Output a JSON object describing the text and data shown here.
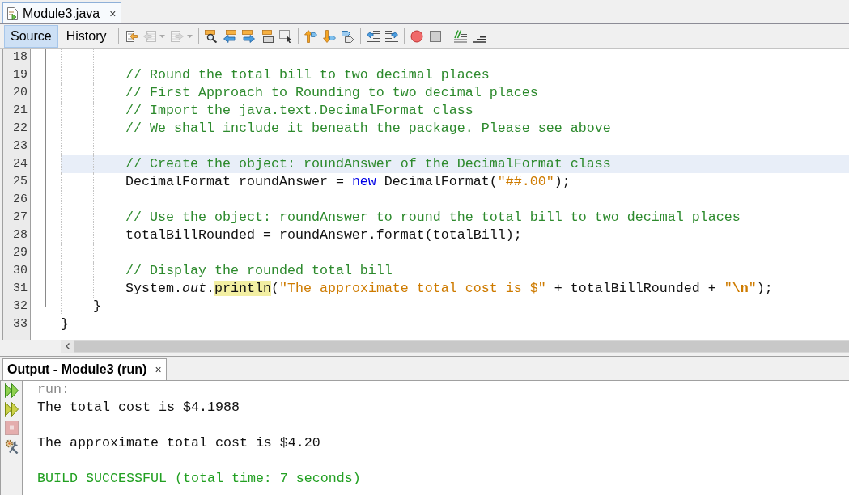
{
  "editor_tab": {
    "title": "Module3.java",
    "close": "×"
  },
  "view_tabs": [
    {
      "label": "Source",
      "selected": true
    },
    {
      "label": "History",
      "selected": false
    }
  ],
  "toolbar": [
    [
      {
        "kind": "button",
        "disabled": false
      },
      {
        "kind": "split",
        "disabled": true
      },
      {
        "kind": "split",
        "disabled": true
      }
    ],
    [
      {
        "kind": "button",
        "disabled": false
      },
      {
        "kind": "button",
        "disabled": false
      },
      {
        "kind": "button",
        "disabled": false
      },
      {
        "kind": "button",
        "disabled": false
      },
      {
        "kind": "button",
        "disabled": false
      }
    ],
    [
      {
        "kind": "button",
        "disabled": false
      },
      {
        "kind": "button",
        "disabled": false
      },
      {
        "kind": "button",
        "disabled": false
      }
    ],
    [
      {
        "kind": "button",
        "disabled": false
      },
      {
        "kind": "button",
        "disabled": false
      }
    ],
    [
      {
        "kind": "button",
        "disabled": false
      },
      {
        "kind": "button",
        "disabled": false
      }
    ],
    [
      {
        "kind": "button",
        "disabled": false
      },
      {
        "kind": "button",
        "disabled": false
      }
    ]
  ],
  "editor": {
    "code": [
      {
        "children": [
          {
            "children": [
              {
                "number": "18",
                "current": false
              },
              {
                "number": "19",
                "current": false,
                "tokens": [
                  {
                    "kind": "comment",
                    "text": "// Round the total bill to two decimal places"
                  }
                ]
              },
              {
                "number": "20",
                "current": false,
                "tokens": [
                  {
                    "kind": "comment",
                    "text": "// First Approach to Rounding to two decimal places"
                  }
                ]
              },
              {
                "number": "21",
                "current": false,
                "tokens": [
                  {
                    "kind": "comment",
                    "text": "// Import the java.text.DecimalFormat class"
                  }
                ]
              },
              {
                "number": "22",
                "current": false,
                "tokens": [
                  {
                    "kind": "comment",
                    "text": "// We shall include it beneath the package. Please see above"
                  }
                ]
              },
              {
                "number": "23",
                "current": false
              },
              {
                "number": "24",
                "current": true,
                "tokens": [
                  {
                    "kind": "comment",
                    "text": "// Create the object: roundAnswer of the DecimalFormat class"
                  }
                ]
              },
              {
                "number": "25",
                "current": false,
                "tokens": [
                  {
                    "kind": "text",
                    "text": "DecimalFormat roundAnswer = "
                  },
                  {
                    "kind": "keyword",
                    "text": "new"
                  },
                  {
                    "kind": "text",
                    "text": " DecimalFormat("
                  },
                  {
                    "kind": "string",
                    "text": "\"##.00\""
                  },
                  {
                    "kind": "text",
                    "text": ");"
                  }
                ]
              },
              {
                "number": "26",
                "current": false
              },
              {
                "number": "27",
                "current": false,
                "tokens": [
                  {
                    "kind": "comment",
                    "text": "// Use the object: roundAnswer to round the total bill to two decimal places"
                  }
                ]
              },
              {
                "number": "28",
                "current": false,
                "tokens": [
                  {
                    "kind": "text",
                    "text": "totalBillRounded = roundAnswer.format(totalBill);"
                  }
                ]
              },
              {
                "number": "29",
                "current": false
              },
              {
                "number": "30",
                "current": false,
                "tokens": [
                  {
                    "kind": "comment",
                    "text": "// Display the rounded total bill"
                  }
                ]
              },
              {
                "number": "31",
                "current": false,
                "tokens": [
                  {
                    "kind": "text",
                    "text": "System."
                  },
                  {
                    "kind": "field",
                    "text": "out"
                  },
                  {
                    "kind": "text",
                    "text": "."
                  },
                  {
                    "kind": "occurrence",
                    "text": "println"
                  },
                  {
                    "kind": "text",
                    "text": "("
                  },
                  {
                    "kind": "string",
                    "text": "\"The approximate total cost is $\""
                  },
                  {
                    "kind": "text",
                    "text": " + totalBillRounded + "
                  },
                  {
                    "kind": "string",
                    "text": "\""
                  },
                  {
                    "kind": "escape",
                    "text": "\\n"
                  },
                  {
                    "kind": "string",
                    "text": "\""
                  },
                  {
                    "kind": "text",
                    "text": ");"
                  }
                ]
              }
            ]
          },
          {
            "number": "32",
            "current": false,
            "tokens": [
              {
                "kind": "text",
                "text": "}"
              }
            ]
          }
        ]
      },
      {
        "number": "33",
        "current": false,
        "tokens": [
          {
            "kind": "text",
            "text": "}"
          }
        ]
      }
    ]
  },
  "output": {
    "tab": {
      "title": "Output - Module3 (run)",
      "close": "×"
    },
    "side_buttons": [
      {
        "disabled": false
      },
      {
        "disabled": false
      },
      {
        "disabled": true
      },
      {
        "disabled": false
      }
    ],
    "lines": [
      {
        "kind": "status",
        "text": "run:"
      },
      {
        "kind": "normal",
        "text": "The total cost is $4.1988"
      },
      {
        "kind": "blank"
      },
      {
        "kind": "normal",
        "text": "The approximate total cost is $4.20"
      },
      {
        "kind": "blank"
      },
      {
        "kind": "success",
        "text": "BUILD SUCCESSFUL (total time: 7 seconds)"
      }
    ]
  }
}
